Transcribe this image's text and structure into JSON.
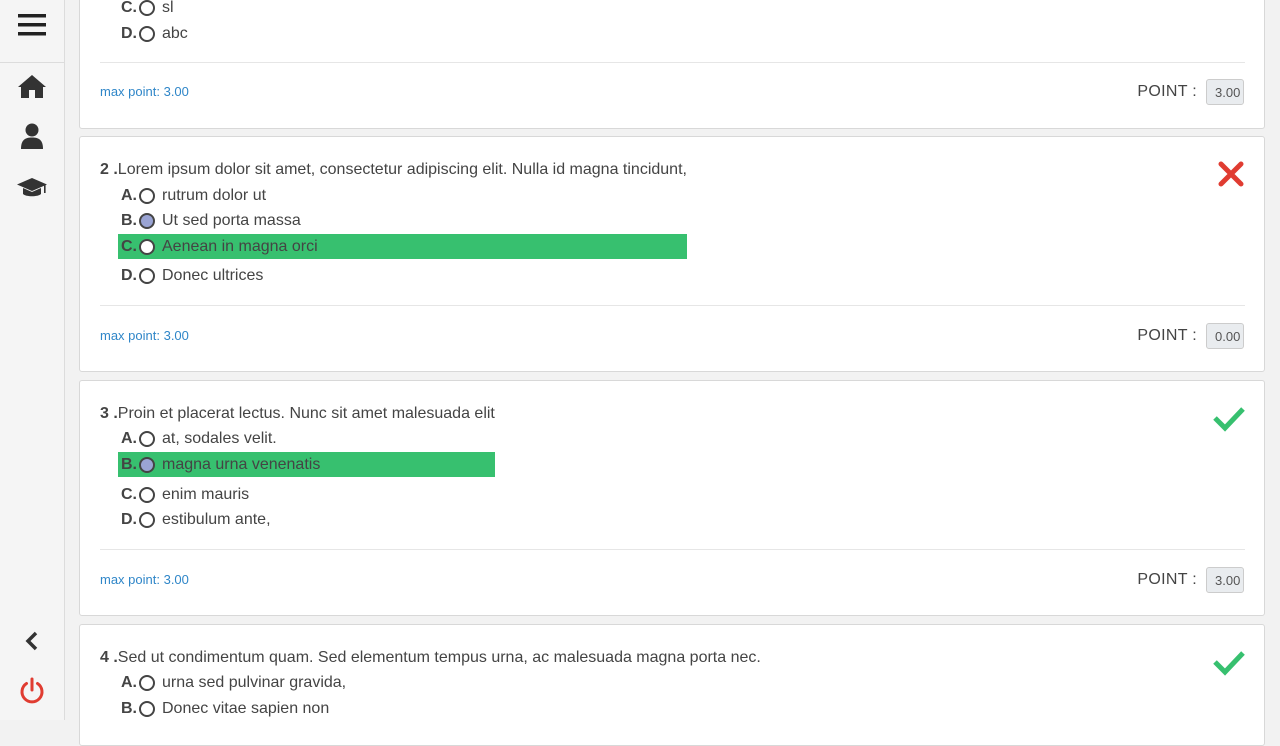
{
  "sidebar": {
    "icons": [
      "menu-icon",
      "home-icon",
      "user-icon",
      "graduation-cap-icon",
      "chevron-left-icon",
      "power-icon"
    ]
  },
  "questions": [
    {
      "options": [
        {
          "letter": "C.",
          "text": "sl"
        },
        {
          "letter": "D.",
          "text": "abc"
        }
      ],
      "max_point": "max point: 3.00",
      "point_label": "POINT :",
      "point_value": "3.00"
    },
    {
      "number": "2 .",
      "text": "Lorem ipsum dolor sit amet, consectetur adipiscing elit. Nulla id magna tincidunt,",
      "status": "incorrect",
      "options": [
        {
          "letter": "A.",
          "text": "rutrum dolor ut"
        },
        {
          "letter": "B.",
          "text": "Ut sed porta massa"
        },
        {
          "letter": "C.",
          "text": "Aenean in magna orci"
        },
        {
          "letter": "D.",
          "text": "Donec ultrices"
        }
      ],
      "selected": "B.",
      "correct": "C.",
      "max_point": "max point: 3.00",
      "point_label": "POINT :",
      "point_value": "0.00"
    },
    {
      "number": "3 .",
      "text": "Proin et placerat lectus. Nunc sit amet malesuada elit",
      "status": "correct",
      "options": [
        {
          "letter": "A.",
          "text": "at, sodales velit."
        },
        {
          "letter": "B.",
          "text": "magna urna venenatis"
        },
        {
          "letter": "C.",
          "text": "enim mauris"
        },
        {
          "letter": "D.",
          "text": "estibulum ante,"
        }
      ],
      "selected": "B.",
      "correct": "B.",
      "max_point": "max point: 3.00",
      "point_label": "POINT :",
      "point_value": "3.00"
    },
    {
      "number": "4 .",
      "text": "Sed ut condimentum quam. Sed elementum tempus urna, ac malesuada magna porta nec.",
      "status": "correct",
      "options": [
        {
          "letter": "A.",
          "text": "urna sed pulvinar gravida,"
        },
        {
          "letter": "B.",
          "text": "Donec vitae sapien non"
        }
      ]
    }
  ],
  "colors": {
    "correct_highlight": "#37c06f",
    "correct_icon": "#37c06f",
    "incorrect_icon": "#e03c31",
    "link_blue": "#2f86c8",
    "selected_radio": "#9aa4d4",
    "power_red": "#e03c31"
  }
}
